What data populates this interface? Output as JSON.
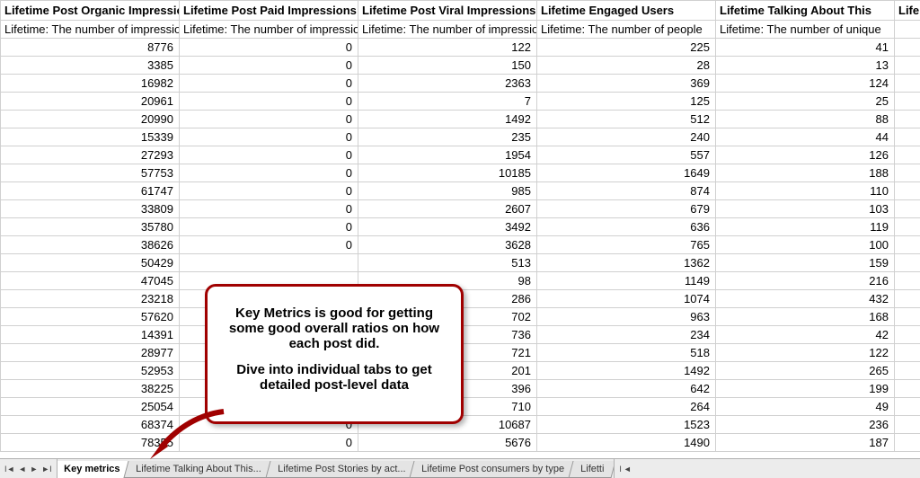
{
  "columns": [
    {
      "header": "Lifetime Post Organic Impressions",
      "desc": "Lifetime: The number of impressions"
    },
    {
      "header": "Lifetime Post Paid Impressions",
      "desc": "Lifetime: The number of impressions"
    },
    {
      "header": "Lifetime Post Viral Impressions",
      "desc": "Lifetime: The number of impressions"
    },
    {
      "header": "Lifetime Engaged Users",
      "desc": "Lifetime: The number of people"
    },
    {
      "header": "Lifetime Talking About This",
      "desc": "Lifetime: The number of unique"
    },
    {
      "header": "Life",
      "desc": ""
    }
  ],
  "rows": [
    [
      8776,
      0,
      122,
      225,
      41,
      ""
    ],
    [
      3385,
      0,
      150,
      28,
      13,
      ""
    ],
    [
      16982,
      0,
      2363,
      369,
      124,
      ""
    ],
    [
      20961,
      0,
      7,
      125,
      25,
      ""
    ],
    [
      20990,
      0,
      1492,
      512,
      88,
      ""
    ],
    [
      15339,
      0,
      235,
      240,
      44,
      ""
    ],
    [
      27293,
      0,
      1954,
      557,
      126,
      ""
    ],
    [
      57753,
      0,
      10185,
      1649,
      188,
      ""
    ],
    [
      61747,
      0,
      985,
      874,
      110,
      ""
    ],
    [
      33809,
      0,
      2607,
      679,
      103,
      ""
    ],
    [
      35780,
      0,
      3492,
      636,
      119,
      ""
    ],
    [
      38626,
      0,
      3628,
      765,
      100,
      ""
    ],
    [
      50429,
      "",
      513,
      1362,
      159,
      ""
    ],
    [
      47045,
      "",
      98,
      1149,
      216,
      ""
    ],
    [
      23218,
      "",
      286,
      1074,
      432,
      ""
    ],
    [
      57620,
      "",
      702,
      963,
      168,
      ""
    ],
    [
      14391,
      "",
      736,
      234,
      42,
      ""
    ],
    [
      28977,
      "",
      721,
      518,
      122,
      ""
    ],
    [
      52953,
      "",
      201,
      1492,
      265,
      ""
    ],
    [
      38225,
      "",
      396,
      642,
      199,
      ""
    ],
    [
      25054,
      "",
      710,
      264,
      49,
      ""
    ],
    [
      68374,
      0,
      10687,
      1523,
      236,
      ""
    ],
    [
      78355,
      0,
      5676,
      1490,
      187,
      ""
    ]
  ],
  "tabs": [
    {
      "label": "Key metrics",
      "active": true
    },
    {
      "label": "Lifetime Talking About This...",
      "active": false
    },
    {
      "label": "Lifetime Post Stories by act...",
      "active": false
    },
    {
      "label": "Lifetime Post consumers by type",
      "active": false
    },
    {
      "label": "Lifetti",
      "active": false
    }
  ],
  "callout": {
    "p1": "Key Metrics is good for getting some good overall ratios on how each post did.",
    "p2": "Dive into individual tabs to get detailed post-level data"
  }
}
